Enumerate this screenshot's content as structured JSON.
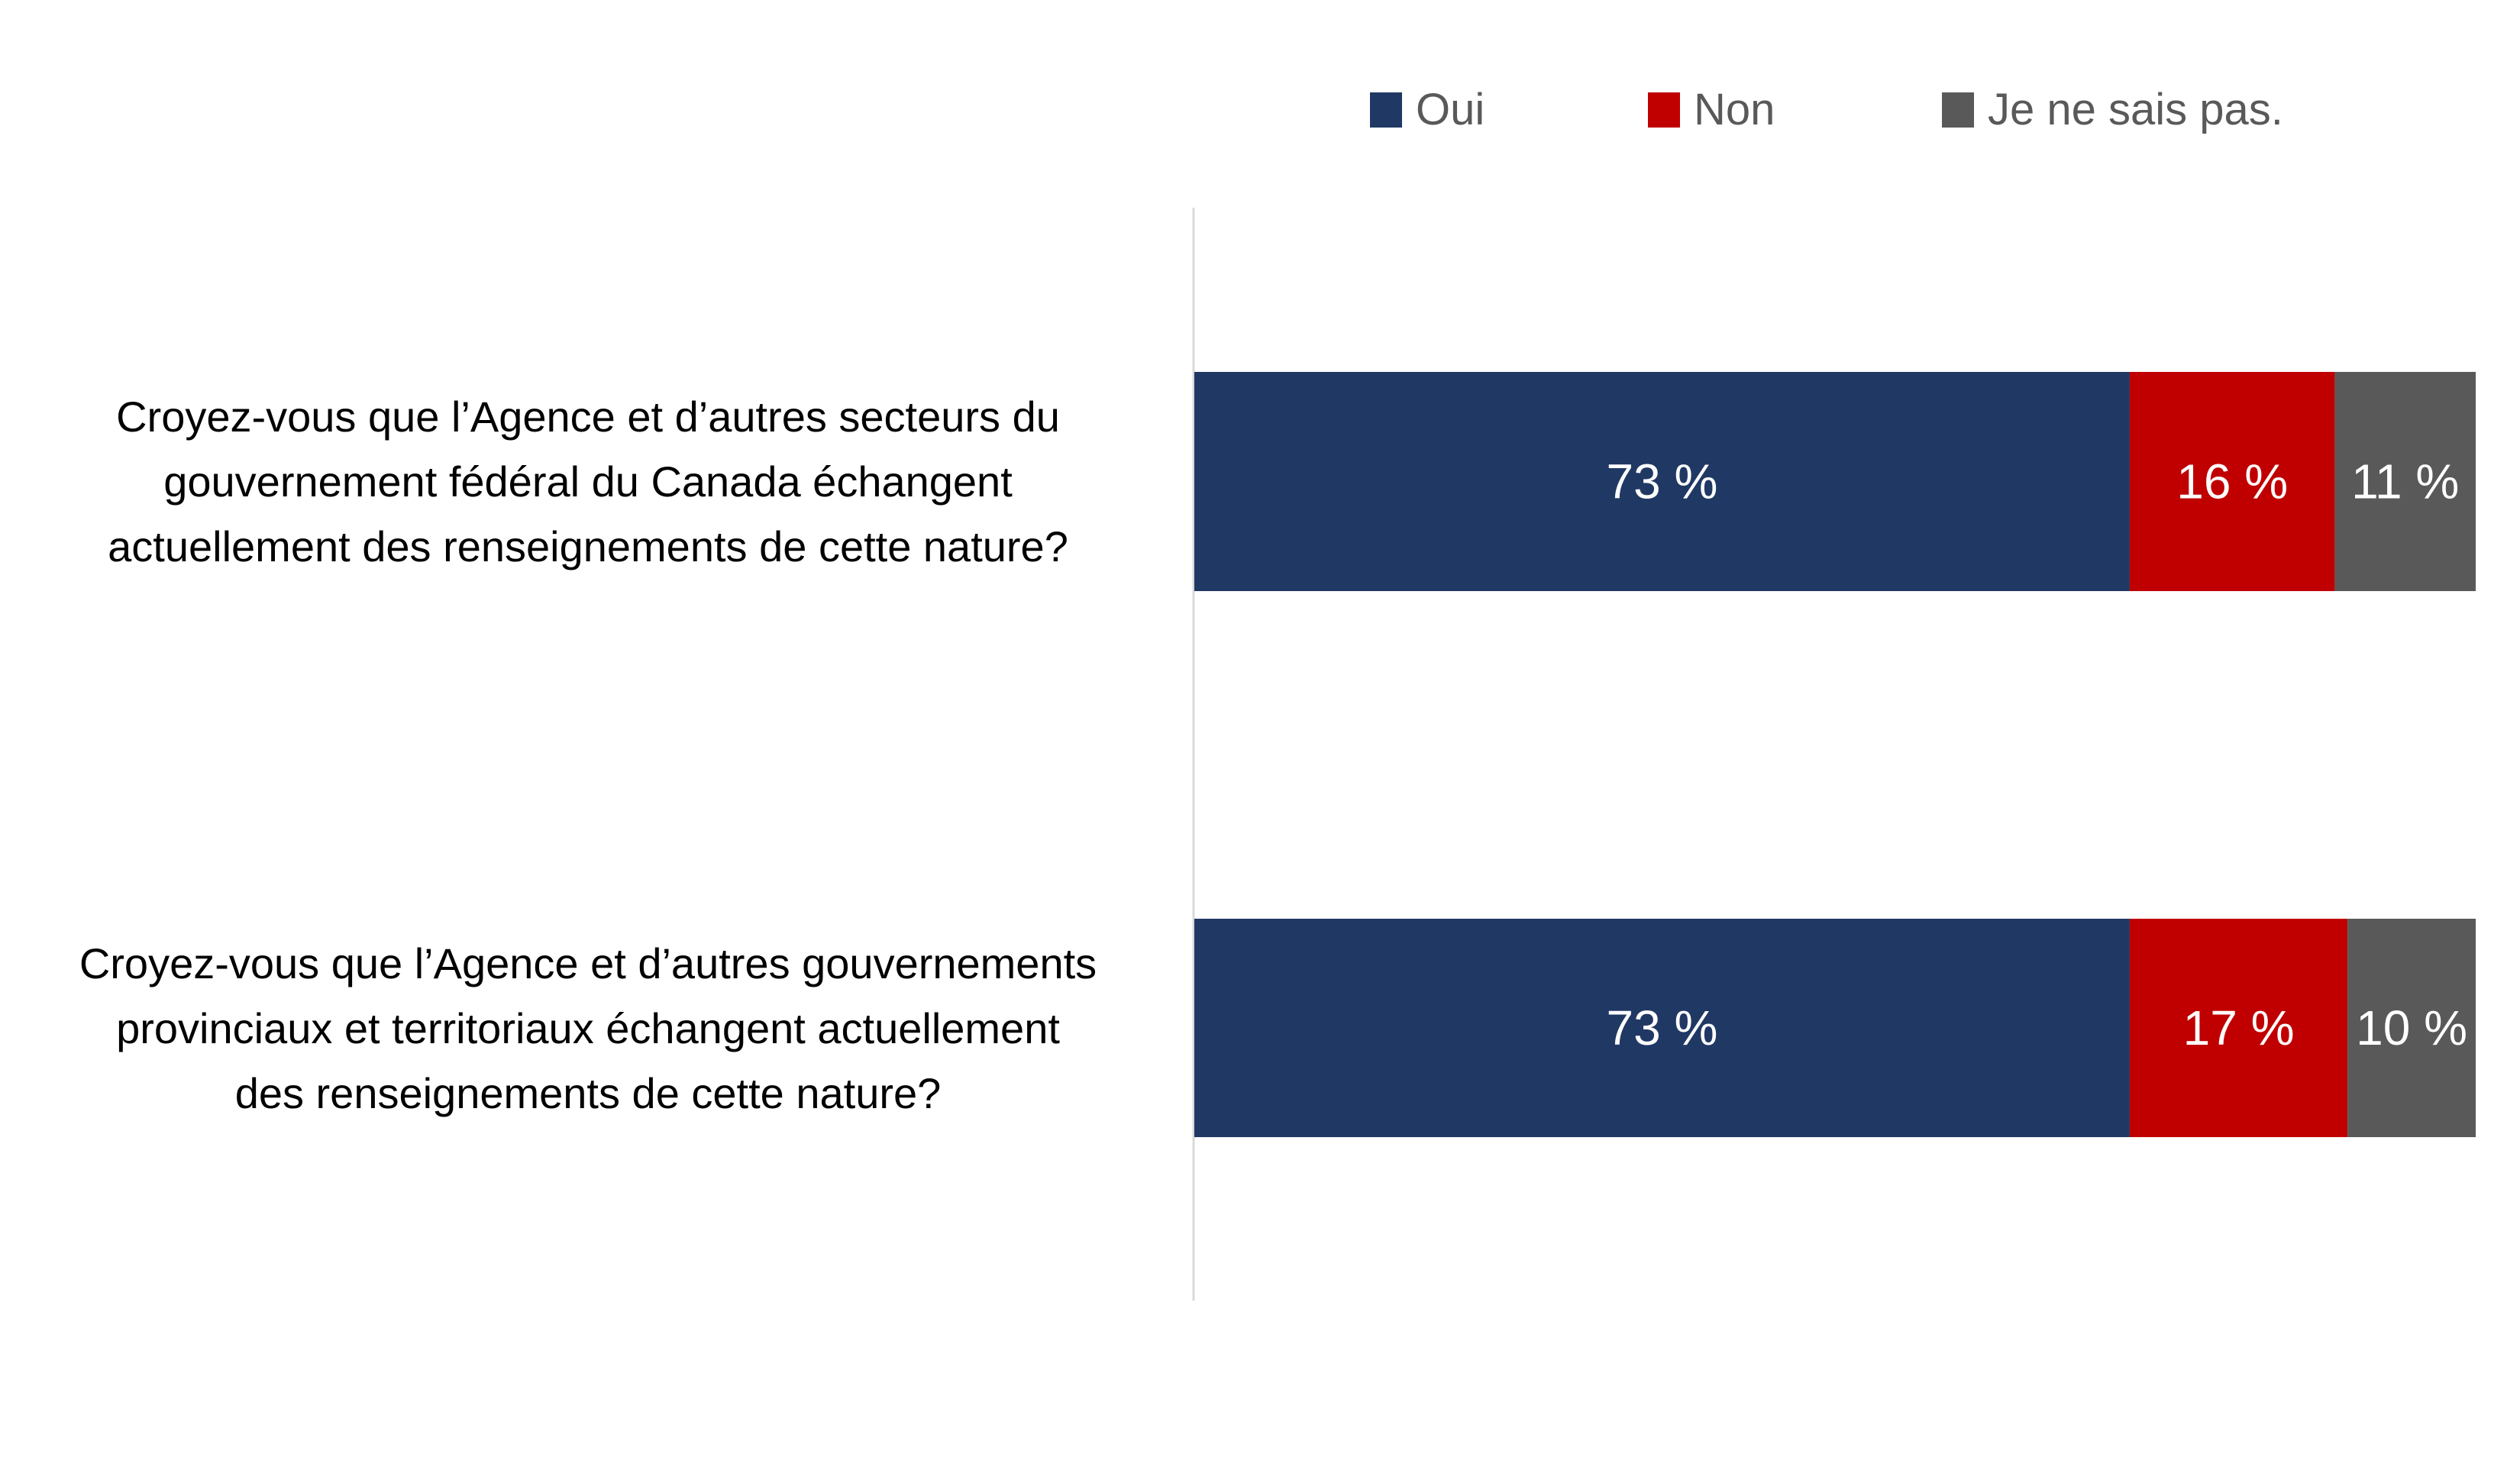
{
  "chart_data": {
    "type": "bar",
    "orientation": "horizontal",
    "stacked": true,
    "title": "",
    "xlabel": "",
    "ylabel": "",
    "xlim": [
      0,
      100
    ],
    "grid": false,
    "legend_position": "top-right",
    "categories": [
      "Croyez-vous que l’Agence et d’autres secteurs du gouvernement fédéral du Canada échangent actuellement des renseignements de cette nature?",
      "Croyez-vous que l’Agence et d’autres gouvernements provinciaux et territoriaux échangent actuellement des renseignements de cette nature?"
    ],
    "category_lines": [
      [
        "Croyez-vous que l’Agence et d’autres secteurs du",
        "gouvernement fédéral du Canada échangent",
        "actuellement des renseignements de cette nature?"
      ],
      [
        "Croyez-vous que l’Agence et d’autres gouvernements",
        "provinciaux et territoriaux échangent actuellement",
        "des renseignements de cette nature?"
      ]
    ],
    "series": [
      {
        "name": "Oui",
        "color": "#203864",
        "values": [
          73,
          73
        ],
        "labels": [
          "73 %",
          "73 %"
        ]
      },
      {
        "name": "Non",
        "color": "#C00000",
        "values": [
          16,
          17
        ],
        "labels": [
          "16 %",
          "17 %"
        ]
      },
      {
        "name": "Je ne sais pas.",
        "color": "#595959",
        "values": [
          11,
          10
        ],
        "labels": [
          "11 %",
          "10 %"
        ]
      }
    ]
  }
}
